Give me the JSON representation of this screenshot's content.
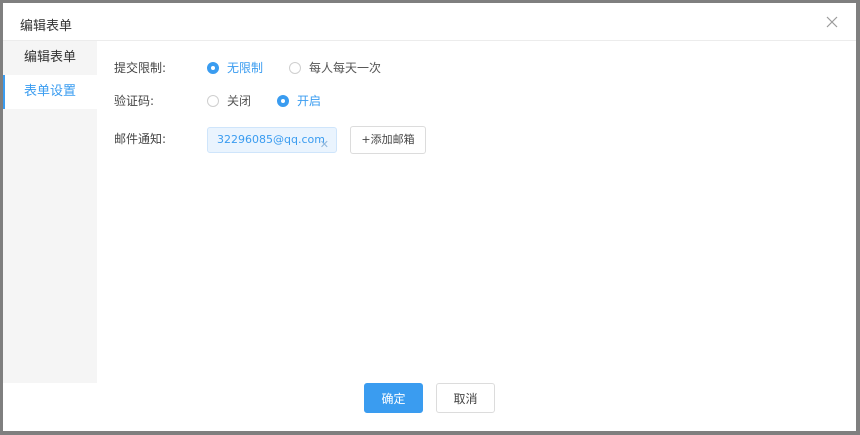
{
  "dialog": {
    "title": "编辑表单"
  },
  "sidebar": {
    "items": [
      {
        "label": "编辑表单"
      },
      {
        "label": "表单设置"
      }
    ]
  },
  "form": {
    "submit_limit": {
      "label": "提交限制:",
      "options": [
        "无限制",
        "每人每天一次"
      ],
      "selected": "无限制"
    },
    "captcha": {
      "label": "验证码:",
      "options": [
        "关闭",
        "开启"
      ],
      "selected": "开启"
    },
    "email_notify": {
      "label": "邮件通知:",
      "tags": [
        "32296085@qq.com"
      ],
      "add_label": "+添加邮箱"
    }
  },
  "footer": {
    "confirm_label": "确定",
    "cancel_label": "取消"
  },
  "colors": {
    "accent": "#3a9cf0",
    "sidebar_bg": "#f5f5f5",
    "tag_bg": "#eaf4fe"
  }
}
